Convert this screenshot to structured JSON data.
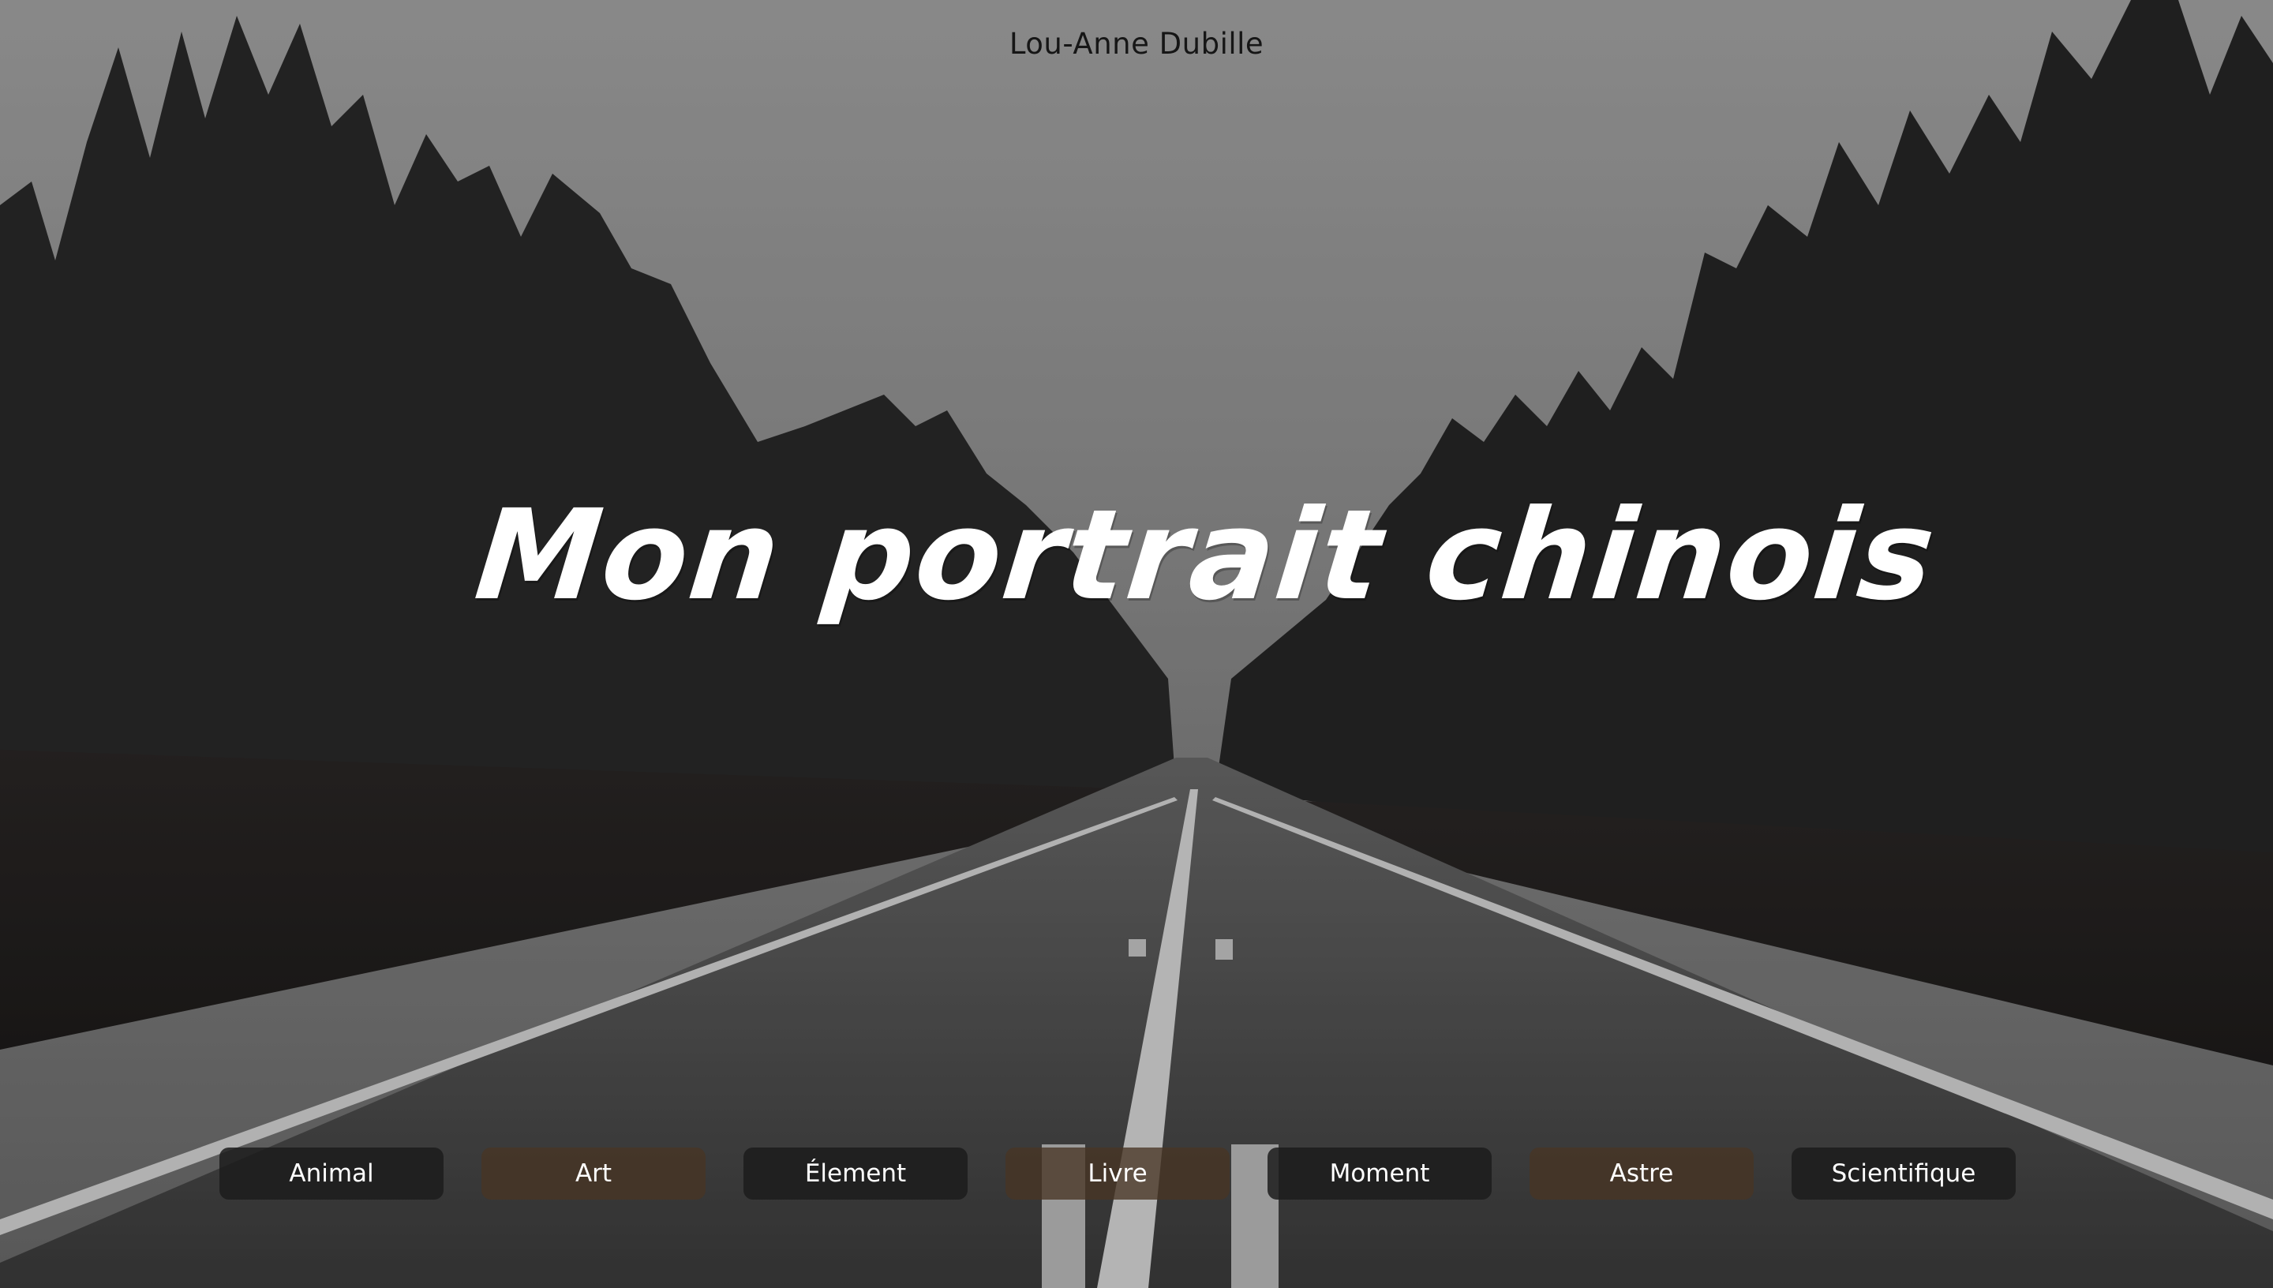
{
  "header": {
    "author": "Lou-Anne Dubille"
  },
  "hero": {
    "title": "Mon portrait chinois"
  },
  "nav": {
    "items": [
      {
        "label": "Animal",
        "style": "dark"
      },
      {
        "label": "Art",
        "style": "brown"
      },
      {
        "label": "Élement",
        "style": "dark"
      },
      {
        "label": "Livre",
        "style": "brown"
      },
      {
        "label": "Moment",
        "style": "dark"
      },
      {
        "label": "Astre",
        "style": "brown"
      },
      {
        "label": "Scientifique",
        "style": "dark"
      }
    ]
  },
  "colors": {
    "button_dark": "#1c1c1c",
    "button_brown": "#483424",
    "title_text": "#ffffff",
    "author_text": "#161616"
  }
}
